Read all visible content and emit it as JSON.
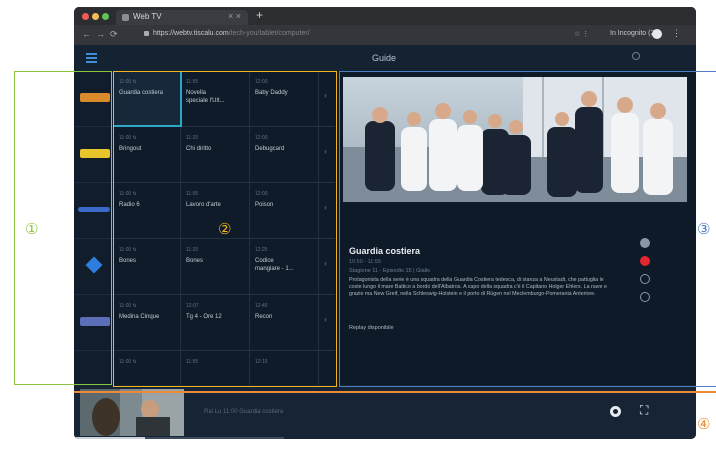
{
  "browser": {
    "tab_title": "Web TV",
    "tab_close": "× ×",
    "new_tab": "+",
    "url_main": "https://webtv.tiscalu.com",
    "url_rest": "/tech-you/tablet/computer/",
    "incognito_label": "In Incognito (2)",
    "nav_back": "←",
    "nav_forward": "→",
    "nav_reload": "⟳",
    "right_icons": "☆  ⋮",
    "menu": "⋮"
  },
  "app": {
    "title": "Guide",
    "channel_logos": [
      {
        "name": "rai-1-logo",
        "color": "#d98b2b"
      },
      {
        "name": "rai-2-logo",
        "color": "#e8c52a"
      },
      {
        "name": "rete-4-logo",
        "color": "#3b69c8"
      },
      {
        "name": "canale-5-logo",
        "color": "#2e7ee0"
      },
      {
        "name": "italia-1-logo",
        "color": "#5a6fb7"
      }
    ],
    "grid_rows": [
      {
        "c1_time": "11:00 ⇅",
        "c1_title": "Guardia costiera",
        "c2_time": "11:55",
        "c2_title": "Novella",
        "c2_title2": "speciale l'Ult...",
        "c3_time": "12:00",
        "c3_title": "Baby Daddy",
        "chev": "›"
      },
      {
        "c1_time": "11:00 ⇅",
        "c1_title": "Bringout",
        "c2_time": "11:25",
        "c2_title": "Chi diritto",
        "c2_title2": "",
        "c3_time": "12:00",
        "c3_title": "Debugcard",
        "chev": "›"
      },
      {
        "c1_time": "11:00 ⇅",
        "c1_title": "Radio 6",
        "c2_time": "11:05",
        "c2_title": "Lavoro d'arte",
        "c2_title2": "",
        "c3_time": "12:00",
        "c3_title": "Poison",
        "chev": "›"
      },
      {
        "c1_time": "11:00 ⇅",
        "c1_title": "Bones",
        "c2_time": "11:25",
        "c2_title": "Bones",
        "c2_title2": "",
        "c3_time": "12:25",
        "c3_title": "Codice",
        "c3_title2": "mangiare - 1...",
        "chev": "›"
      },
      {
        "c1_time": "11:00 ⇅",
        "c1_title": "Medina Cinque",
        "c2_time": "12:07",
        "c2_title": "Tg 4 - Ore 12",
        "c2_title2": "",
        "c3_time": "12:45",
        "c3_title": "Recon",
        "chev": "›"
      },
      {
        "c1_time": "11:00 ⇅",
        "c1_title": "",
        "c2_time": "11:55",
        "c2_title": "",
        "c2_title2": "",
        "c3_time": "12:15",
        "c3_title": "",
        "chev": ""
      }
    ],
    "details": {
      "title": "Guardia costiera",
      "time": "10:50 - 11:55",
      "season": "Stagione 11 - Episodio 15 | Giallo",
      "description": "Protagonista della serie è una squadra della Guardia Costiera tedesca, di stanza a Neustadt, che pattuglia le coste lungo il mare Baltico a bordo dell'Albatros. A capo della squadra c'è il Capitano Holger Ehlers. La nave e grazie ma New Greif, nella Schleswig-Holstein e il porto di Rügen nel Meclemburgo-Pomerania Anteriore.",
      "availability": "Replay disponibile"
    },
    "player": {
      "text": "Rai Lu 11:00 Guardia costiera",
      "progress": 0.34
    }
  },
  "annotations": {
    "n1": "①",
    "n2": "②",
    "n3": "③",
    "n4": "④",
    "colors": {
      "green": "#8cc63f",
      "yellow": "#f1b51c",
      "blue": "#4f7fc4",
      "orange": "#ec8a35"
    }
  }
}
